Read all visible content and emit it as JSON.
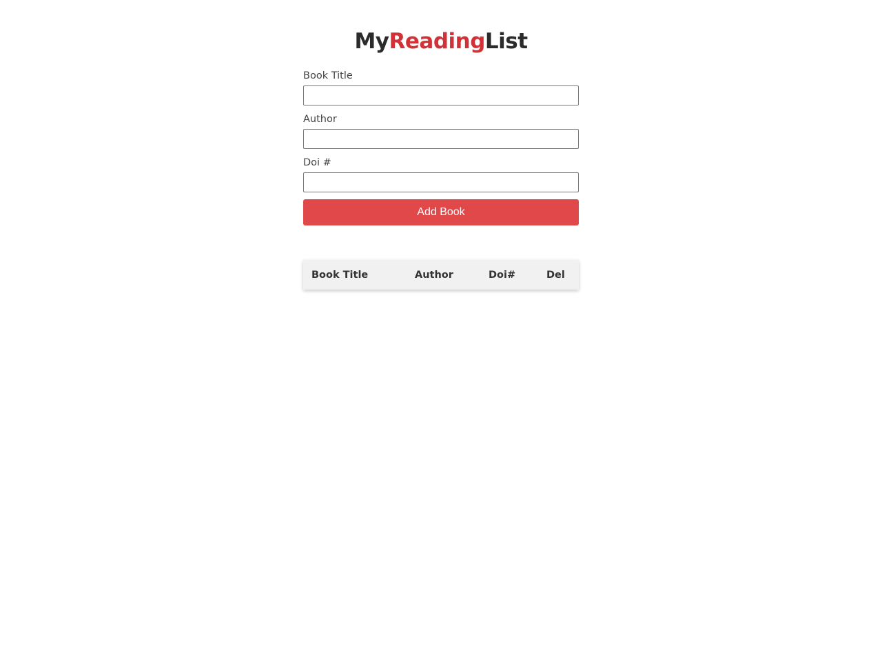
{
  "header": {
    "title_part1": "My",
    "title_part2": "Reading",
    "title_part3": "List",
    "accent_color": "#d03237"
  },
  "form": {
    "book_title_label": "Book Title",
    "book_title_value": "",
    "author_label": "Author",
    "author_value": "",
    "doi_label": "Doi #",
    "doi_value": "",
    "submit_label": "Add Book",
    "submit_color": "#e04849"
  },
  "table": {
    "columns": [
      "Book Title",
      "Author",
      "Doi#",
      "Del"
    ],
    "rows": []
  }
}
